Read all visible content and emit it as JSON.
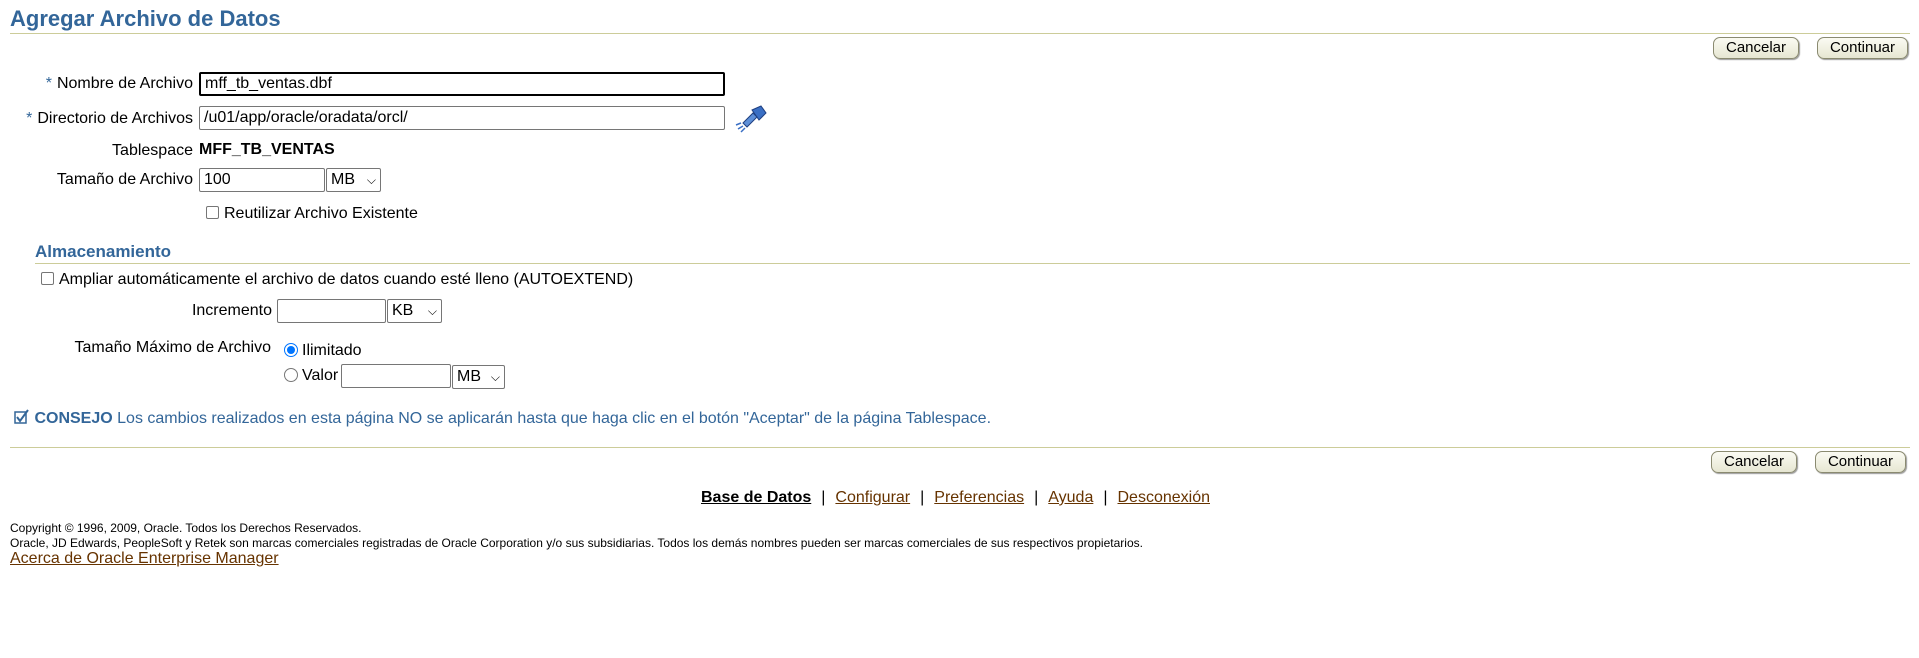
{
  "page": {
    "title": "Agregar Archivo de Datos"
  },
  "buttons": {
    "cancel": "Cancelar",
    "continue": "Continuar"
  },
  "form": {
    "file_name_label": "Nombre de Archivo",
    "file_name_value": "mff_tb_ventas.dbf",
    "directory_label": "Directorio de Archivos",
    "directory_value": "/u01/app/oracle/oradata/orcl/",
    "required_mark": "*",
    "tablespace_label": "Tablespace",
    "tablespace_value": "MFF_TB_VENTAS",
    "size_label": "Tamaño de Archivo",
    "size_value": "100",
    "size_unit": "MB",
    "reuse_label": "Reutilizar Archivo Existente",
    "reuse_checked": false
  },
  "storage": {
    "title": "Almacenamiento",
    "autoextend_label": "Ampliar automáticamente el archivo de datos cuando esté lleno (AUTOEXTEND)",
    "autoextend_checked": false,
    "increment_label": "Incremento",
    "increment_value": "",
    "increment_unit": "KB",
    "max_size_label": "Tamaño Máximo de Archivo",
    "unlimited_label": "Ilimitado",
    "value_label": "Valor",
    "value_value": "",
    "value_unit": "MB",
    "selected_option": "Ilimitado"
  },
  "tip": {
    "label": "CONSEJO",
    "text": "Los cambios realizados en esta página NO se aplicarán hasta que haga clic en el botón \"Aceptar\" de la página Tablespace."
  },
  "footer": {
    "links": [
      "Base de Datos",
      "Configurar",
      "Preferencias",
      "Ayuda",
      "Desconexión"
    ],
    "separator": "|",
    "copyright": "Copyright © 1996, 2009, Oracle. Todos los Derechos Reservados.",
    "trademark": "Oracle, JD Edwards, PeopleSoft y Retek son marcas comerciales registradas de Oracle Corporation y/o sus subsidiarias. Todos los demás nombres pueden ser marcas comerciales de sus respectivos propietarios.",
    "about_link": "Acerca de Oracle Enterprise Manager"
  },
  "colors": {
    "heading": "#336699",
    "divider": "#cccc99",
    "footer_link": "#663300"
  }
}
